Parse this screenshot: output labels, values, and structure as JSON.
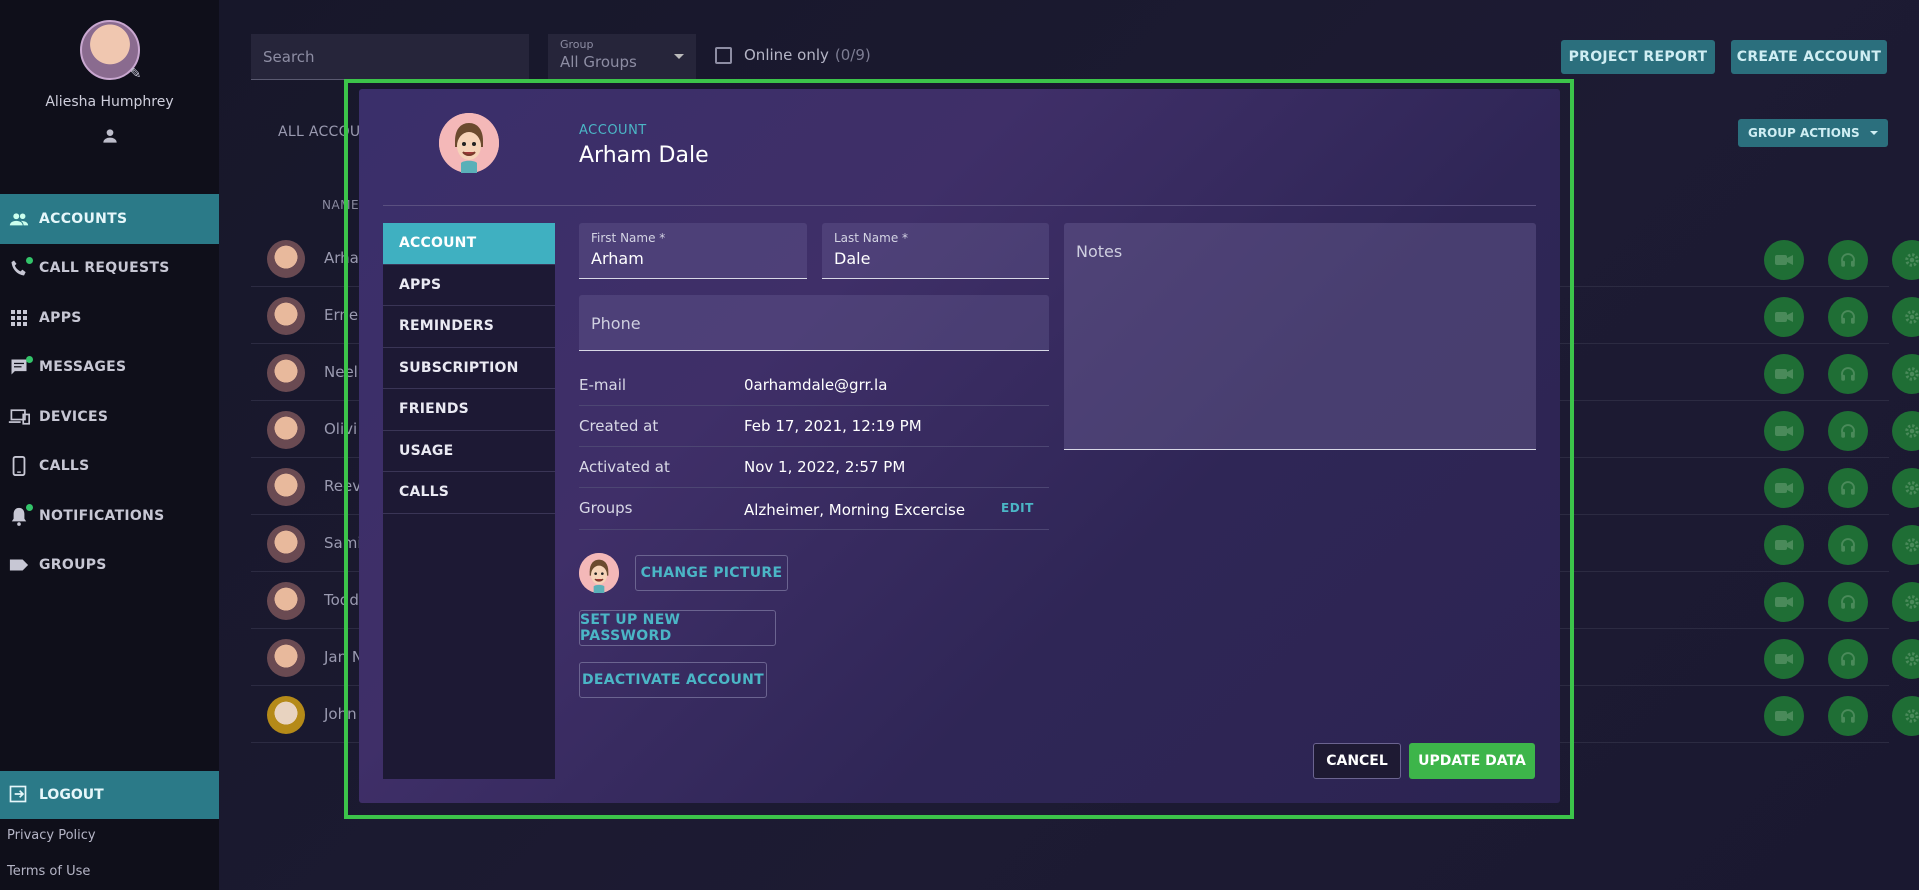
{
  "colors": {
    "accent": "#2b7a88",
    "modal_accent": "#3fb0c1",
    "success": "#3db54a",
    "highlight": "#3cc44a"
  },
  "profile": {
    "name": "Aliesha Humphrey",
    "icon": "person-icon"
  },
  "sidebar": {
    "items": [
      {
        "label": "ACCOUNTS",
        "icon": "people-icon",
        "active": true
      },
      {
        "label": "CALL REQUESTS",
        "icon": "phone-icon",
        "active": false
      },
      {
        "label": "APPS",
        "icon": "grid-icon",
        "active": false
      },
      {
        "label": "MESSAGES",
        "icon": "message-icon",
        "active": false
      },
      {
        "label": "DEVICES",
        "icon": "devices-icon",
        "active": false
      },
      {
        "label": "CALLS",
        "icon": "smartphone-icon",
        "active": false
      },
      {
        "label": "NOTIFICATIONS",
        "icon": "bell-icon",
        "active": false
      },
      {
        "label": "GROUPS",
        "icon": "label-icon",
        "active": false
      }
    ],
    "logout": "LOGOUT",
    "privacy": "Privacy Policy",
    "terms": "Terms of Use"
  },
  "toolbar": {
    "search_placeholder": "Search",
    "group_label": "Group",
    "group_value": "All Groups",
    "online_only": "Online only",
    "online_count": "(0/9)",
    "project_report": "PROJECT REPORT",
    "create_account": "CREATE ACCOUNT",
    "group_actions": "GROUP ACTIONS"
  },
  "list": {
    "tab": "ALL ACCOU",
    "col_name": "NAME",
    "rows": [
      "Arha",
      "Erne",
      "Neel",
      "Olivi",
      "Reev",
      "Sami",
      "Todd",
      "Jan N",
      "John"
    ]
  },
  "modal": {
    "kicker": "ACCOUNT",
    "title": "Arham Dale",
    "tabs": [
      "ACCOUNT",
      "APPS",
      "REMINDERS",
      "SUBSCRIPTION",
      "FRIENDS",
      "USAGE",
      "CALLS"
    ],
    "first_name_label": "First Name *",
    "first_name": "Arham",
    "last_name_label": "Last Name *",
    "last_name": "Dale",
    "phone_placeholder": "Phone",
    "notes_placeholder": "Notes",
    "info": [
      {
        "key": "E-mail",
        "value": "0arhamdale@grr.la"
      },
      {
        "key": "Created at",
        "value": "Feb 17, 2021, 12:19 PM"
      },
      {
        "key": "Activated at",
        "value": "Nov 1, 2022, 2:57 PM"
      },
      {
        "key": "Groups",
        "value": "Alzheimer, Morning Excercise"
      }
    ],
    "edit": "EDIT",
    "change_picture": "CHANGE PICTURE",
    "setup_password": "SET UP NEW PASSWORD",
    "deactivate": "DEACTIVATE ACCOUNT",
    "cancel": "CANCEL",
    "update": "UPDATE DATA"
  }
}
